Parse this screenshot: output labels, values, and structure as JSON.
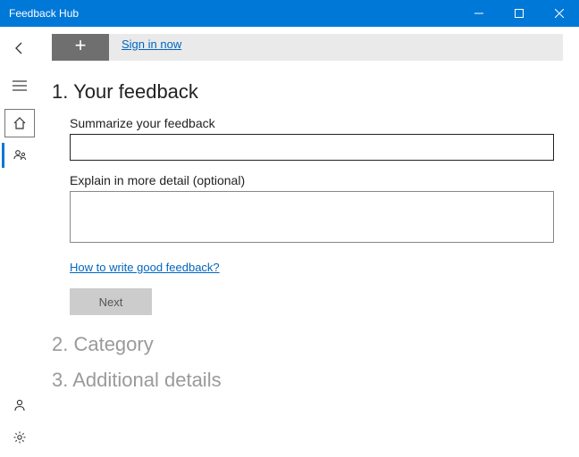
{
  "window": {
    "title": "Feedback Hub"
  },
  "signin": {
    "link": "Sign in now"
  },
  "steps": {
    "s1": {
      "heading": "1. Your feedback"
    },
    "s2": {
      "heading": "2. Category"
    },
    "s3": {
      "heading": "3. Additional details"
    }
  },
  "form": {
    "summary_label": "Summarize your feedback",
    "detail_label": "Explain in more detail (optional)",
    "help_link": "How to write good feedback?",
    "next": "Next"
  }
}
